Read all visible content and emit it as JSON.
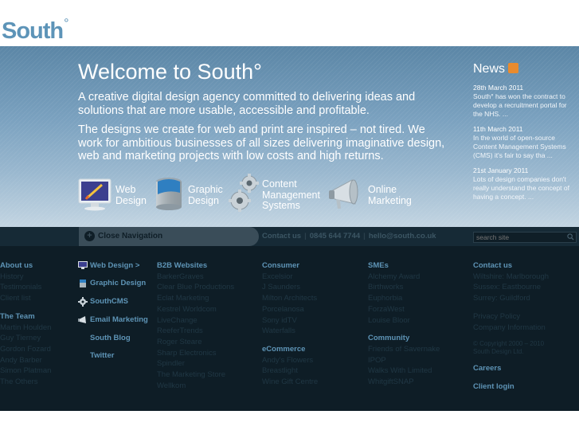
{
  "header": {
    "logo_text": "South",
    "logo_degree": "°"
  },
  "hero": {
    "title": "Welcome to South°",
    "intro": "A creative digital design agency committed to delivering ideas and solutions that are more usable, accessible and profitable.",
    "body": "The designs we create for web and print are inspired – not tired. We work for ambitious businesses of all sizes delivering imaginative design, web and marketing projects with low costs and high returns.",
    "services": [
      {
        "line1": "Web",
        "line2": "Design",
        "icon": "monitor-icon"
      },
      {
        "line1": "Graphic",
        "line2": "Design",
        "icon": "paint-can-icon"
      },
      {
        "line1": "Content",
        "line2": "Management",
        "line3": "Systems",
        "icon": "gears-icon"
      },
      {
        "line1": "Online",
        "line2": "Marketing",
        "icon": "megaphone-icon"
      }
    ]
  },
  "news": {
    "title": "News",
    "items": [
      {
        "date": "28th March 2011",
        "text": "South° has won the contract to develop a recruitment portal for the NHS. ..."
      },
      {
        "date": "11th March 2011",
        "text": "In the world of open-source Content Management Systems (CMS) it's fair to say tha ..."
      },
      {
        "date": "21st January 2011",
        "text": "Lots of design companies don't really understand the concept of having a concept. ..."
      }
    ]
  },
  "navstrip": {
    "close_nav": "Close Navigation",
    "contact_us": "Contact us",
    "phone": "0845 644 7744",
    "email": "hello@south.co.uk",
    "search_placeholder": "search site"
  },
  "footer": {
    "about": {
      "heading": "About us",
      "links": [
        "History",
        "Testimonials",
        "Client list"
      ]
    },
    "team": {
      "heading": "The Team",
      "links": [
        "Martin Houlden",
        "Guy Tierney",
        "Gordon Fozard",
        "Andy Barber",
        "Simon Platman",
        "The Others"
      ]
    },
    "services": [
      "Web Design >",
      "Graphic Design",
      "SouthCMS",
      "Email Marketing",
      "South Blog",
      "Twitter"
    ],
    "b2b": {
      "heading": "B2B Websites",
      "links": [
        "BarkerGraves",
        "Clear Blue Productions",
        "Eclat Marketing",
        "Kestrel Worldcom",
        "LiveChange",
        "ReeferTrends",
        "Roger Steare",
        "Sharp Electronics",
        "Spindler",
        "The Marketing Store",
        "Wellkom"
      ]
    },
    "consumer": {
      "heading": "Consumer",
      "links": [
        "Excelsior",
        "J Saunders",
        "Milton Architects",
        "Porcelanosa",
        "Sony idTV",
        "Waterfalls"
      ]
    },
    "ecommerce": {
      "heading": "eCommerce",
      "links": [
        "Andy's Flowers",
        "Breastlight",
        "Wine Gift Centre"
      ]
    },
    "smes": {
      "heading": "SMEs",
      "links": [
        "Alchemy Award",
        "Birthworks",
        "Euphorbia",
        "ForzaWest",
        "Louise Bloor"
      ]
    },
    "community": {
      "heading": "Community",
      "links": [
        "Friends of Savernake",
        "IPOP",
        "Walks With Limited",
        "WhitgiftSNAP"
      ]
    },
    "contact": {
      "heading": "Contact us",
      "links": [
        "Wiltshire: Marlborough",
        "Sussex: Eastbourne",
        "Surrey: Guildford"
      ]
    },
    "info": [
      "Privacy Policy",
      "Company Information"
    ],
    "copyright_1": "© Copyright 2000 – 2010",
    "copyright_2": "South Design Ltd.",
    "careers": "Careers",
    "client_login": "Client login"
  },
  "colors": {
    "accent": "#5e94b6",
    "footer_bg": "#0e1d26",
    "footer_link": "#203744"
  }
}
